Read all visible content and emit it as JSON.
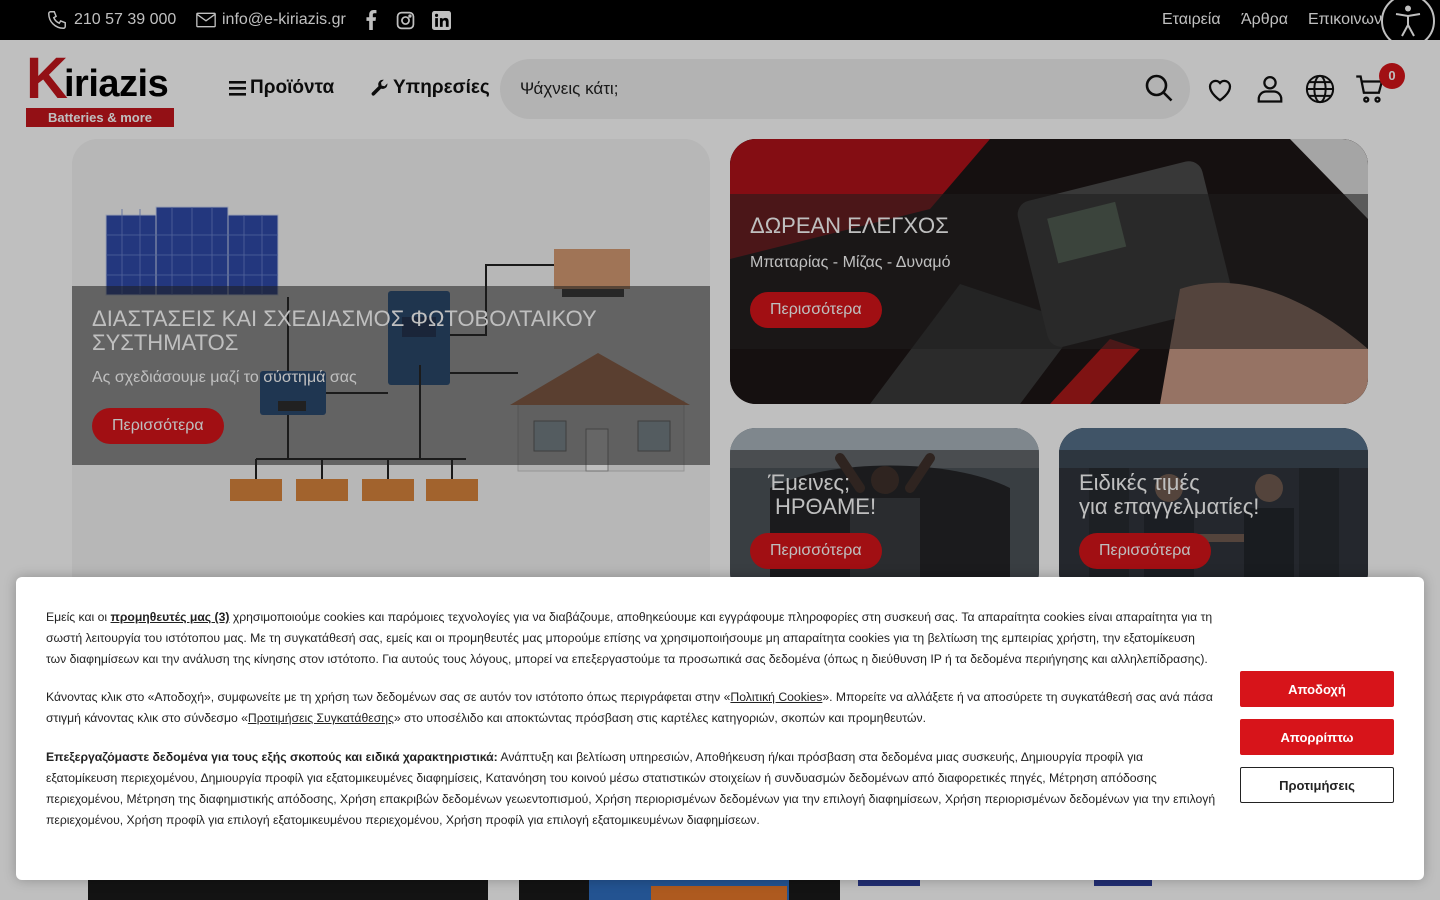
{
  "topbar": {
    "phone": "210 57 39 000",
    "email": "info@e-kiriazis.gr",
    "links": [
      "Εταιρεία",
      "Άρθρα",
      "Επικοινωνία"
    ]
  },
  "header": {
    "logo_k": "K",
    "logo_rest": "iriazis",
    "logo_tagline": "Batteries & more",
    "nav": [
      "Προϊόντα",
      "Υπηρεσίες"
    ],
    "search_placeholder": "Ψάχνεις κάτι;",
    "cart_count": "0"
  },
  "banners": {
    "big": {
      "title": "ΔΙΑΣΤΑΣΕΙΣ ΚΑΙ ΣΧΕΔΙΑΣΜΟΣ ΦΩΤΟΒΟΛΤΑΙΚΟΥ ΣΥΣΤΗΜΑΤΟΣ",
      "subtitle": "Ας σχεδιάσουμε μαζί το σύστημά σας",
      "button": "Περισσότερα"
    },
    "top": {
      "title": "ΔΩΡΕΑΝ ΕΛΕΓΧΟΣ",
      "subtitle": "Μπαταρίας - Μίζας - Δυναμό",
      "button": "Περισσότερα"
    },
    "small1": {
      "title_line1": "Έμεινες;",
      "title_line2": "ΗΡΘΑΜΕ!",
      "button": "Περισσότερα"
    },
    "small2": {
      "title_line1": "Ειδικές τιμές",
      "title_line2": "για επαγγελματίες!",
      "button": "Περισσότερα"
    }
  },
  "cookie": {
    "p1_start": "Εμείς και οι ",
    "p1_link": "προμηθευτές μας (3)",
    "p1_rest": " χρησιμοποιούμε cookies και παρόμοιες τεχνολογίες για να διαβάζουμε, αποθηκεύουμε και εγγράφουμε πληροφορίες στη συσκευή σας. Τα απαραίτητα cookies είναι απαραίτητα για τη σωστή λειτουργία του ιστότοπου μας. Με τη συγκατάθεσή σας, εμείς και οι προμηθευτές μας μπορούμε επίσης να χρησιμοποιήσουμε μη απαραίτητα cookies για τη βελτίωση της εμπειρίας χρήστη, την εξατομίκευση των διαφημίσεων και την ανάλυση της κίνησης στον ιστότοπο. Για αυτούς τους λόγους, μπορεί να επεξεργαστούμε τα προσωπικά σας δεδομένα (όπως η διεύθυνση IP ή τα δεδομένα περιήγησης και αλληλεπίδρασης).",
    "p2_start": "Κάνοντας κλικ στο «Αποδοχή», συμφωνείτε με τη χρήση των δεδομένων σας σε αυτόν τον ιστότοπο όπως περιγράφεται στην «",
    "p2_link1": "Πολιτική Cookies",
    "p2_mid": "». Μπορείτε να αλλάξετε ή να αποσύρετε τη συγκατάθεσή σας ανά πάσα στιγμή κάνοντας κλικ στο σύνδεσμο «",
    "p2_link2": "Προτιμήσεις Συγκατάθεσης",
    "p2_end": "» στο υποσέλιδο και αποκτώντας πρόσβαση στις καρτέλες κατηγοριών, σκοπών και προμηθευτών.",
    "p3_bold": "Επεξεργαζόμαστε δεδομένα για τους εξής σκοπούς και ειδικά χαρακτηριστικά:",
    "p3_rest": " Ανάπτυξη και βελτίωση υπηρεσιών, Αποθήκευση ή/και πρόσβαση στα δεδομένα μιας συσκευής, Δημιουργία προφίλ για εξατομίκευση περιεχομένου, Δημιουργία προφίλ για εξατομικευμένες διαφημίσεις, Κατανόηση του κοινού μέσω στατιστικών στοιχείων ή συνδυασμών δεδομένων από διαφορετικές πηγές, Μέτρηση απόδοσης περιεχομένου, Μέτρηση της διαφημιστικής απόδοσης, Χρήση επακριβών δεδομένων γεωεντοπισμού, Χρήση περιορισμένων δεδομένων για την επιλογή διαφημίσεων, Χρήση περιορισμένων δεδομένων για την επιλογή περιεχομένου, Χρήση προφίλ για επιλογή εξατομικευμένου περιεχομένου, Χρήση προφίλ για επιλογή εξατομικευμένων διαφημίσεων.",
    "accept": "Αποδοχή",
    "reject": "Απορρίπτω",
    "prefs": "Προτιμήσεις"
  },
  "colors": {
    "brand_red": "#d7141a",
    "logo_red": "#c4161c",
    "topbar_bg": "#000000"
  }
}
